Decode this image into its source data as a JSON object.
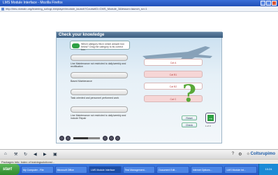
{
  "window": {
    "title": "LMS Module Interface - Mozilla Firefox"
  },
  "address": {
    "url": "http://lms.domain.org/learning_sol/cgi-bin/player/module_launch?CourseID=CMS_Module_3&lesson=launch_sv=1"
  },
  "panel": {
    "title": "Check your knowledge",
    "question": "Which category fits in which answer box below? Drag the category to its correct box.",
    "left_items": [
      {
        "label": "Line Maintenance not restricted to daily/weekly and rectification"
      },
      {
        "label": "Based Maintenance"
      },
      {
        "label": "Task oriented and personnel performed work"
      },
      {
        "label": "Line Maintenance not restricted to daily/weekly and include Repair"
      }
    ],
    "right_items": [
      {
        "label": "Cat A"
      },
      {
        "label": "Cat B1"
      },
      {
        "label": "Cat B2"
      },
      {
        "label": "Cat C"
      }
    ],
    "qmark": "?",
    "buttons": {
      "reset": "Reset",
      "check": "Check"
    },
    "next_glyph": "→",
    "page_indicator": "1 of 3"
  },
  "player": {
    "progress": 0.55
  },
  "browser_toolbar": {
    "logo": "Coltsrupimo"
  },
  "statusbar": {
    "text": "Packages Info: Index of trainingsolutions/..."
  },
  "taskbar": {
    "start": "start",
    "tasks": [
      "My Computer - File",
      "Microsoft Office",
      "LMS Module Interface",
      "Test Management...",
      "Document Edit...",
      "Internet Options...",
      "LMS Module Int..."
    ],
    "clock": "10:24"
  },
  "colors": {
    "accent": "#2ea043",
    "header": "#3d5f80",
    "taskbar": "#2457c5"
  }
}
